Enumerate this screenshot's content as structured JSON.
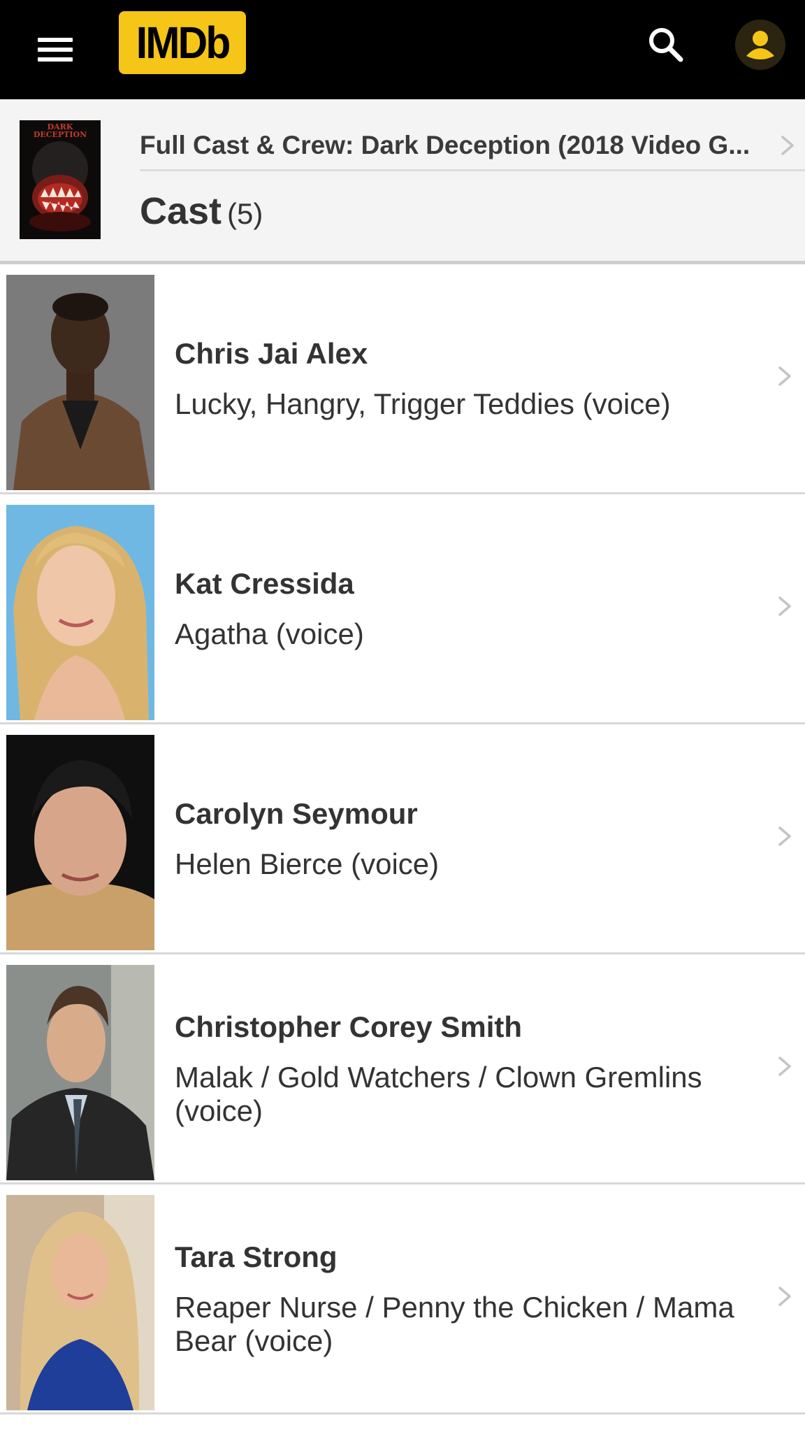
{
  "topbar": {
    "menu_icon": "hamburger-menu-icon",
    "logo_text": "IMDb",
    "logo_color": "#f5c518",
    "search_icon": "search-icon",
    "profile_icon": "user-avatar-icon"
  },
  "header": {
    "title": "Full Cast & Crew: Dark Deception (2018 Video G...",
    "poster_title": "DARK DECEPTION",
    "section_label": "Cast",
    "section_count": "(5)"
  },
  "cast": [
    {
      "name": "Chris Jai Alex",
      "role": "Lucky, Hangry, Trigger Teddies (voice)"
    },
    {
      "name": "Kat Cressida",
      "role": "Agatha (voice)"
    },
    {
      "name": "Carolyn Seymour",
      "role": "Helen Bierce (voice)"
    },
    {
      "name": "Christopher Corey Smith",
      "role": "Malak / Gold Watchers / Clown Gremlins (voice)"
    },
    {
      "name": "Tara Strong",
      "role": "Reaper Nurse / Penny the Chicken / Mama Bear (voice)"
    }
  ]
}
